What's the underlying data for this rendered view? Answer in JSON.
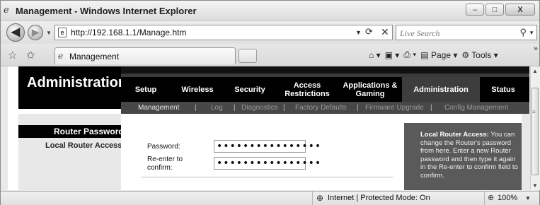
{
  "window": {
    "title": "Management - Windows Internet Explorer",
    "buttons": {
      "minimize": "–",
      "maximize": "□",
      "close": "X"
    }
  },
  "addressbar": {
    "url": "http://192.168.1.1/Manage.htm",
    "search_placeholder": "Live Search"
  },
  "tabs": [
    {
      "label": "Management"
    }
  ],
  "commandbar": {
    "page_label": "Page",
    "tools_label": "Tools"
  },
  "router": {
    "section_title": "Administration",
    "main_menu": [
      {
        "label": "Setup"
      },
      {
        "label": "Wireless"
      },
      {
        "label": "Security"
      },
      {
        "label": "Access Restrictions"
      },
      {
        "label": "Applications & Gaming"
      },
      {
        "label": "Administration",
        "active": true
      },
      {
        "label": "Status"
      }
    ],
    "sub_menu": [
      {
        "label": "Management",
        "active": true
      },
      {
        "label": "Log"
      },
      {
        "label": "Diagnostics"
      },
      {
        "label": "Factory Defaults"
      },
      {
        "label": "Firmware Upgrade"
      },
      {
        "label": "Config Management"
      }
    ],
    "sidebar": {
      "heading": "Router Password",
      "item": "Local Router Access"
    },
    "form": {
      "password_label": "Password:",
      "password_value": "••••••••••••••••",
      "reenter_label_line1": "Re-enter to",
      "reenter_label_line2": "confirm:",
      "reenter_value": "••••••••••••••••"
    },
    "help": {
      "heading": "Local Router Access:",
      "body": " You can change the Router's password from here. Enter a new Router password and then type it again in the Re-enter to confirm field to confirm."
    }
  },
  "statusbar": {
    "zone": "Internet | Protected Mode: On",
    "zoom": "100%"
  },
  "icons": [
    "ie-logo-icon",
    "back-icon",
    "forward-icon",
    "page-icon",
    "refresh-icon",
    "stop-icon",
    "search-icon",
    "favorites-star-icon",
    "add-favorites-icon",
    "home-icon",
    "feeds-icon",
    "print-icon",
    "page-menu-icon",
    "tools-gear-icon",
    "globe-icon",
    "zoom-icon"
  ]
}
